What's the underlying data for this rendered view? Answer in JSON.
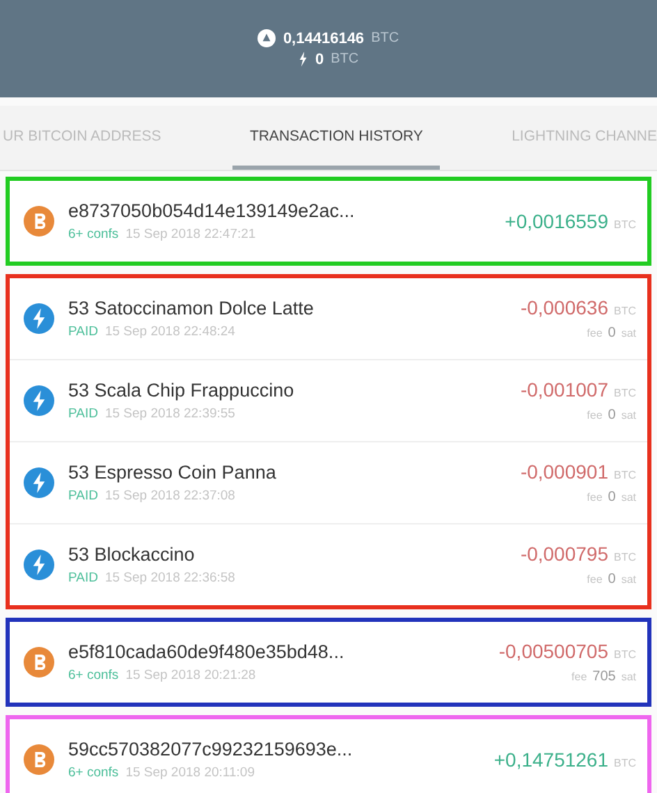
{
  "balance": {
    "onchain": {
      "amount": "0,14416146",
      "unit": "BTC"
    },
    "lightning": {
      "amount": "0",
      "unit": "BTC"
    }
  },
  "tabs": [
    {
      "label": "UR BITCOIN ADDRESS",
      "selected": false
    },
    {
      "label": "TRANSACTION HISTORY",
      "selected": true
    },
    {
      "label": "LIGHTNING CHANNE",
      "selected": false
    }
  ],
  "groups": [
    {
      "color": "#22cc22",
      "transactions": [
        {
          "kind": "onchain",
          "title": "e8737050b054d14e139149e2ac...",
          "status": "6+ confs",
          "date": "15 Sep 2018 22:47:21",
          "amount": "+0,0016559",
          "unit": "BTC",
          "incoming": true
        }
      ]
    },
    {
      "color": "#e8301e",
      "transactions": [
        {
          "kind": "lightning",
          "title": "53 Satoccinamon Dolce Latte",
          "status": "PAID",
          "date": "15 Sep 2018 22:48:24",
          "amount": "-0,000636",
          "unit": "BTC",
          "incoming": false,
          "fee_label": "fee",
          "fee": "0",
          "fee_unit": "sat"
        },
        {
          "kind": "lightning",
          "title": "53 Scala Chip Frappuccino",
          "status": "PAID",
          "date": "15 Sep 2018 22:39:55",
          "amount": "-0,001007",
          "unit": "BTC",
          "incoming": false,
          "fee_label": "fee",
          "fee": "0",
          "fee_unit": "sat"
        },
        {
          "kind": "lightning",
          "title": "53 Espresso Coin Panna",
          "status": "PAID",
          "date": "15 Sep 2018 22:37:08",
          "amount": "-0,000901",
          "unit": "BTC",
          "incoming": false,
          "fee_label": "fee",
          "fee": "0",
          "fee_unit": "sat"
        },
        {
          "kind": "lightning",
          "title": "53 Blockaccino",
          "status": "PAID",
          "date": "15 Sep 2018 22:36:58",
          "amount": "-0,000795",
          "unit": "BTC",
          "incoming": false,
          "fee_label": "fee",
          "fee": "0",
          "fee_unit": "sat"
        }
      ]
    },
    {
      "color": "#2233bb",
      "transactions": [
        {
          "kind": "onchain",
          "title": "e5f810cada60de9f480e35bd48...",
          "status": "6+ confs",
          "date": "15 Sep 2018 20:21:28",
          "amount": "-0,00500705",
          "unit": "BTC",
          "incoming": false,
          "fee_label": "fee",
          "fee": "705",
          "fee_unit": "sat"
        }
      ]
    },
    {
      "color": "#ee66ee",
      "transactions": [
        {
          "kind": "onchain",
          "title": "59cc570382077c99232159693e...",
          "status": "6+ confs",
          "date": "15 Sep 2018 20:11:09",
          "amount": "+0,14751261",
          "unit": "BTC",
          "incoming": true
        }
      ]
    }
  ]
}
